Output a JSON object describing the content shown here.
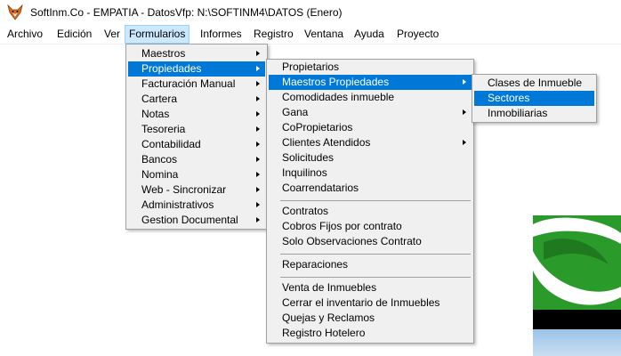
{
  "window": {
    "title": "SoftInm.Co - EMPATIA - DatosVfp: N:\\SOFTINM4\\DATOS  (Enero)"
  },
  "menubar": {
    "items": [
      "Archivo",
      "Edición",
      "Ver",
      "Formularios",
      "Informes",
      "Registro",
      "Ventana",
      "Ayuda",
      "Proyecto"
    ],
    "active": "Formularios"
  },
  "formularios_menu": {
    "items": [
      {
        "label": "Maestros",
        "submenu": true
      },
      {
        "label": "Propiedades",
        "submenu": true,
        "highlighted": true
      },
      {
        "label": "Facturación Manual",
        "submenu": true
      },
      {
        "label": "Cartera",
        "submenu": true
      },
      {
        "label": "Notas",
        "submenu": true
      },
      {
        "label": "Tesoreria",
        "submenu": true
      },
      {
        "label": "Contabilidad",
        "submenu": true
      },
      {
        "label": "Bancos",
        "submenu": true
      },
      {
        "label": "Nomina",
        "submenu": true
      },
      {
        "label": "Web - Sincronizar",
        "submenu": true
      },
      {
        "label": "Administrativos",
        "submenu": true
      },
      {
        "label": "Gestion Documental",
        "submenu": true
      }
    ]
  },
  "propiedades_menu": {
    "items": [
      {
        "label": "Propietarios"
      },
      {
        "label": "Maestros Propiedades",
        "submenu": true,
        "highlighted": true
      },
      {
        "label": "Comodidades inmueble"
      },
      {
        "label": "Gana",
        "submenu": true
      },
      {
        "label": "CoPropietarios"
      },
      {
        "label": "Clientes Atendidos",
        "submenu": true
      },
      {
        "label": "Solicitudes"
      },
      {
        "label": "Inquilinos"
      },
      {
        "label": "Coarrendatarios"
      },
      {
        "label": "Contratos"
      },
      {
        "label": "Cobros Fijos por contrato"
      },
      {
        "label": "Solo Observaciones Contrato"
      },
      {
        "label": "Reparaciones"
      },
      {
        "label": "Venta de Inmuebles"
      },
      {
        "label": "Cerrar el inventario de Inmuebles"
      },
      {
        "label": "Quejas y Reclamos"
      },
      {
        "label": "Registro Hotelero"
      }
    ]
  },
  "maestros_propiedades_menu": {
    "items": [
      {
        "label": "Clases de Inmueble"
      },
      {
        "label": "Sectores",
        "highlighted": true
      },
      {
        "label": "Inmobiliarias"
      }
    ]
  },
  "colors": {
    "menu_bg": "#f0f0f0",
    "highlight": "#0078d7",
    "menubar_active": "#cce8ff",
    "logo_green": "#2a9a2a"
  }
}
